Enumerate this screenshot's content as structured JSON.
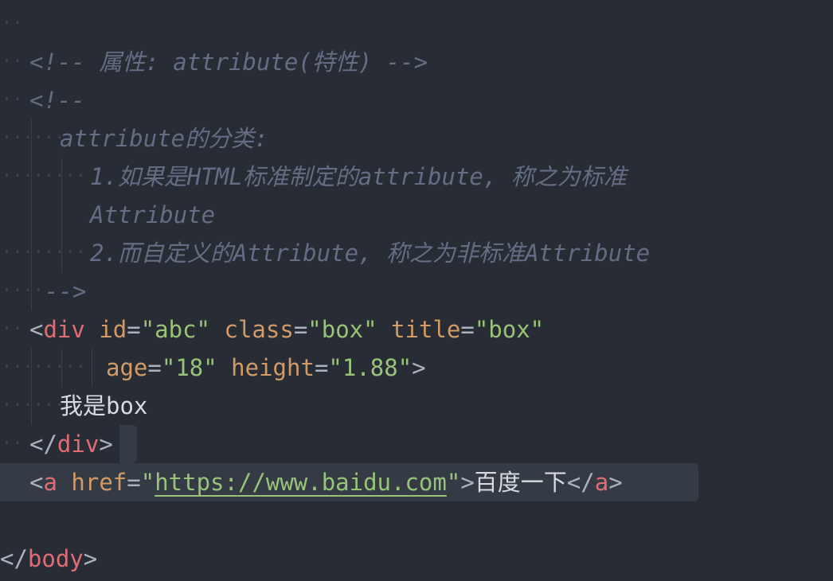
{
  "editor": {
    "language": "html",
    "colors": {
      "background": "#282c34",
      "comment": "#636d83",
      "tag": "#e06c75",
      "attribute": "#d19a66",
      "string": "#98c379",
      "punctuation": "#abb2bf",
      "text": "#d7dae0",
      "highlight": "#353b45"
    },
    "lines": {
      "l1_c": "<!-- 属性: attribute(特性) -->",
      "l2_c": "<!--",
      "l3_c": "attribute的分类:",
      "l4_c": "1.如果是HTML标准制定的attribute, 称之为标准",
      "l5_c": "Attribute",
      "l6_c": "2.而自定义的Attribute, 称之为非标准Attribute",
      "l7_c": "-->",
      "div_open_lt": "<",
      "div_tag": "div",
      "id_attr": "id",
      "eq1": "=",
      "id_val": "\"abc\"",
      "class_attr": "class",
      "eq2": "=",
      "class_val": "\"box\"",
      "title_attr": "title",
      "eq3": "=",
      "title_val": "\"box\"",
      "age_attr": "age",
      "eq4": "=",
      "age_val": "\"18\"",
      "height_attr": "height",
      "eq5": "=",
      "height_val": "\"1.88\"",
      "div_open_gt": ">",
      "div_text": "我是box",
      "div_close_lt": "</",
      "div_close_tag": "div",
      "div_close_gt": ">",
      "a_lt": "<",
      "a_tag": "a",
      "href_attr": "href",
      "eq6": "=",
      "q_open": "\"",
      "href_url": "https://www.baidu.com",
      "q_close": "\"",
      "a_gt": ">",
      "a_text": "百度一下",
      "a_close_lt": "</",
      "a_close_tag": "a",
      "a_close_gt": ">",
      "body_close_lt": "</",
      "body_tag": "body",
      "body_close_gt": ">"
    }
  }
}
